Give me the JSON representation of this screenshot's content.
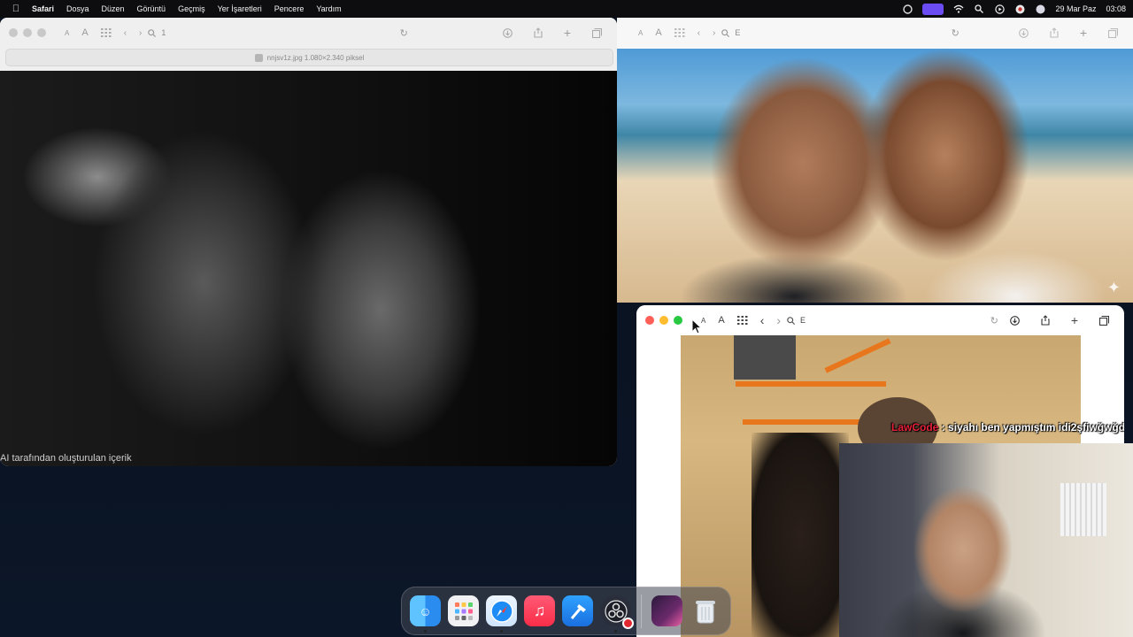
{
  "menubar": {
    "app": "Safari",
    "items": [
      "Dosya",
      "Düzen",
      "Görüntü",
      "Geçmiş",
      "Yer İşaretleri",
      "Pencere",
      "Yardım"
    ],
    "date": "29 Mar Paz",
    "time": "03:08"
  },
  "left_window": {
    "address": "1",
    "tab_title": "nnjsv1z.jpg 1.080×2.340 piksel",
    "caption": "AI tarafından oluşturulan içerik"
  },
  "top_right_window": {
    "address": "E"
  },
  "bottom_right_window": {
    "address": "E",
    "chat": {
      "username": "LawCode",
      "message": ": siyahı ben yapmıştım idi2şfiwğwğd"
    }
  },
  "dock": {
    "apps": [
      "finder-icon",
      "launchpad-icon",
      "safari-icon",
      "music-icon",
      "xcode-icon",
      "obs-icon",
      "stream-thumbnail-icon",
      "trash-icon"
    ]
  },
  "colors": {
    "traffic_red": "#ff5f57",
    "traffic_yellow": "#febc2e",
    "traffic_green": "#28c840",
    "chat_username": "#e8213a",
    "menubar_accent": "#6b4cf2"
  }
}
